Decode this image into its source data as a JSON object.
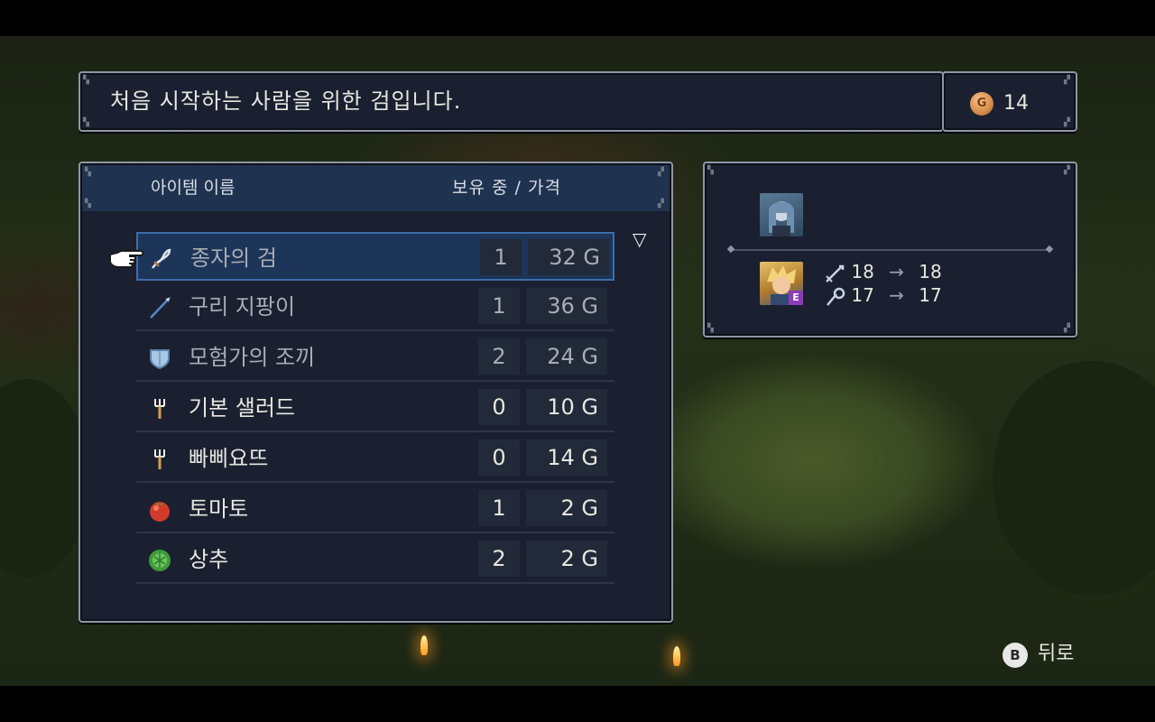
{
  "description": "처음 시작하는 사람을 위한 검입니다.",
  "gold": {
    "icon": "gold-coin-icon",
    "coin_letter": "G",
    "amount": "14"
  },
  "list": {
    "header_name": "아이템 이름",
    "header_price": "보유 중 / 가격",
    "scroll_indicator": "▽",
    "items": [
      {
        "icon": "sword-icon",
        "name": "종자의 검",
        "owned": "1",
        "price": "32 G",
        "selected": true
      },
      {
        "icon": "staff-icon",
        "name": "구리 지팡이",
        "owned": "1",
        "price": "36 G"
      },
      {
        "icon": "shield-icon",
        "name": "모험가의 조끼",
        "owned": "2",
        "price": "24 G"
      },
      {
        "icon": "fork-icon",
        "name": "기본 샐러드",
        "owned": "0",
        "price": "10 G"
      },
      {
        "icon": "fork-icon",
        "name": "빠삐요뜨",
        "owned": "0",
        "price": "14 G"
      },
      {
        "icon": "tomato-icon",
        "name": "토마토",
        "owned": "1",
        "price": "2 G"
      },
      {
        "icon": "lettuce-icon",
        "name": "상추",
        "owned": "2",
        "price": "2 G"
      }
    ]
  },
  "party": {
    "equip_badge": "E",
    "stats": [
      {
        "icon": "attack-sword-icon",
        "from": "18",
        "arrow": "→",
        "to": "18"
      },
      {
        "icon": "magic-staff-icon",
        "from": "17",
        "arrow": "→",
        "to": "17"
      }
    ]
  },
  "back": {
    "button": "B",
    "label": "뒤로"
  },
  "colors": {
    "panel": "#1a2030",
    "header": "#1f3350",
    "selected_row": "#1d3558",
    "gold": "#d78b4a",
    "equip": "#8c3cb8"
  }
}
